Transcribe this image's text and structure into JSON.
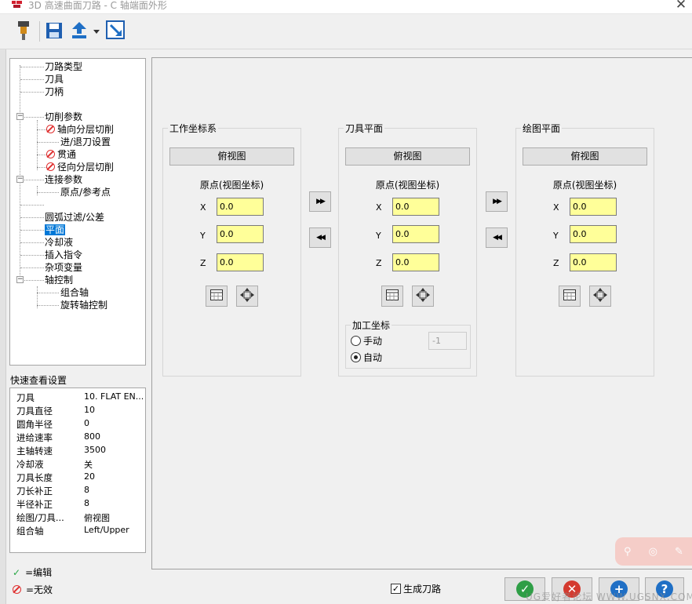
{
  "window": {
    "title": "3D 高速曲面刀路 - C 轴端面外形",
    "close_symbol": "✕"
  },
  "tree": {
    "items": [
      {
        "label": "刀路类型",
        "invalid": false
      },
      {
        "label": "刀具",
        "invalid": false
      },
      {
        "label": "刀柄",
        "invalid": false
      },
      {
        "label": "切削参数",
        "invalid": false,
        "expander": "−"
      },
      {
        "label": "轴向分层切削",
        "invalid": true
      },
      {
        "label": "进/退刀设置",
        "invalid": false
      },
      {
        "label": "贯通",
        "invalid": true
      },
      {
        "label": "径向分层切削",
        "invalid": true
      },
      {
        "label": "连接参数",
        "invalid": false,
        "expander": "−"
      },
      {
        "label": "原点/参考点",
        "invalid": false
      },
      {
        "label": "圆弧过滤/公差",
        "invalid": false
      },
      {
        "label": "平面",
        "invalid": false,
        "selected": true
      },
      {
        "label": "冷却液",
        "invalid": false
      },
      {
        "label": "插入指令",
        "invalid": false
      },
      {
        "label": "杂项变量",
        "invalid": false
      },
      {
        "label": "轴控制",
        "invalid": false,
        "expander": "−"
      },
      {
        "label": "组合轴",
        "invalid": false
      },
      {
        "label": "旋转轴控制",
        "invalid": false
      }
    ]
  },
  "quick_view": {
    "title": "快速查看设置",
    "rows": [
      {
        "key": "刀具",
        "value": "10. FLAT EN..."
      },
      {
        "key": "刀具直径",
        "value": "10"
      },
      {
        "key": "圆角半径",
        "value": "0"
      },
      {
        "key": "进给速率",
        "value": "800"
      },
      {
        "key": "主轴转速",
        "value": "3500"
      },
      {
        "key": "冷却液",
        "value": "关"
      },
      {
        "key": "刀具长度",
        "value": "20"
      },
      {
        "key": "刀长补正",
        "value": "8"
      },
      {
        "key": "半径补正",
        "value": "8"
      },
      {
        "key": "绘图/刀具...",
        "value": "俯视图"
      },
      {
        "key": "组合轴",
        "value": "Left/Upper"
      }
    ]
  },
  "legend": {
    "edit": "=编辑",
    "invalid": "=无效"
  },
  "planes": {
    "work": {
      "title": "工作坐标系",
      "view": "俯视图",
      "origin_label": "原点(视图坐标)",
      "x_label": "X",
      "x": "0.0",
      "y_label": "Y",
      "y": "0.0",
      "z_label": "Z",
      "z": "0.0"
    },
    "tool": {
      "title": "刀具平面",
      "view": "俯视图",
      "origin_label": "原点(视图坐标)",
      "x_label": "X",
      "x": "0.0",
      "y_label": "Y",
      "y": "0.0",
      "z_label": "Z",
      "z": "0.0"
    },
    "draw": {
      "title": "绘图平面",
      "view": "俯视图",
      "origin_label": "原点(视图坐标)",
      "x_label": "X",
      "x": "0.0",
      "y_label": "Y",
      "y": "0.0",
      "z_label": "Z",
      "z": "0.0"
    }
  },
  "machining_coords": {
    "title": "加工坐标",
    "manual": "手动",
    "auto": "自动",
    "manual_value": "-1",
    "selected": "auto"
  },
  "copy_buttons": {
    "forward": "▶▶",
    "back": "◀◀"
  },
  "generate_toolpath": {
    "label": "生成刀路",
    "checked": true
  },
  "icons": {
    "toolbar": [
      "tool-icon",
      "save-icon",
      "export-icon",
      "dropdown-arrow-icon",
      "minimize-icon"
    ],
    "bottom": [
      "ok-icon",
      "cancel-icon",
      "add-icon",
      "help-icon"
    ]
  },
  "watermark": "UG爱好者论坛  WWW.UGSNX.COM",
  "colors": {
    "input_yellow": "#ffff99",
    "selected_blue": "#0078d7",
    "invalid_red": "#e03030",
    "ok_green": "#2e9e46"
  }
}
